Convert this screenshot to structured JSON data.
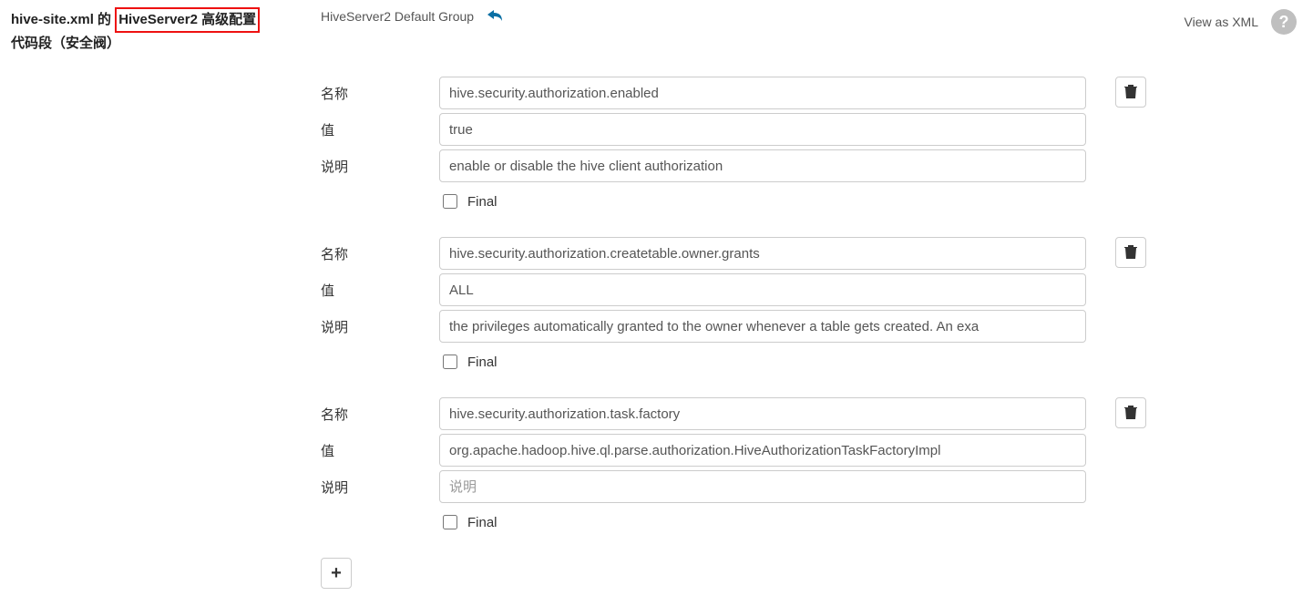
{
  "header": {
    "title_pre": "hive-site.xml 的",
    "title_highlight": "HiveServer2 高级配置",
    "title_post": "代码段（安全阀）",
    "group": "HiveServer2 Default Group",
    "view_xml": "View as XML"
  },
  "labels": {
    "name": "名称",
    "value": "值",
    "desc": "说明",
    "final": "Final",
    "desc_placeholder": "说明"
  },
  "props": [
    {
      "name": "hive.security.authorization.enabled",
      "value": "true",
      "desc": "enable or disable the hive client authorization",
      "final": false
    },
    {
      "name": "hive.security.authorization.createtable.owner.grants",
      "value": "ALL",
      "desc": "the privileges automatically granted to the owner whenever a table gets created. An exa",
      "final": false
    },
    {
      "name": "hive.security.authorization.task.factory",
      "value": "org.apache.hadoop.hive.ql.parse.authorization.HiveAuthorizationTaskFactoryImpl",
      "desc": "",
      "final": false
    }
  ]
}
